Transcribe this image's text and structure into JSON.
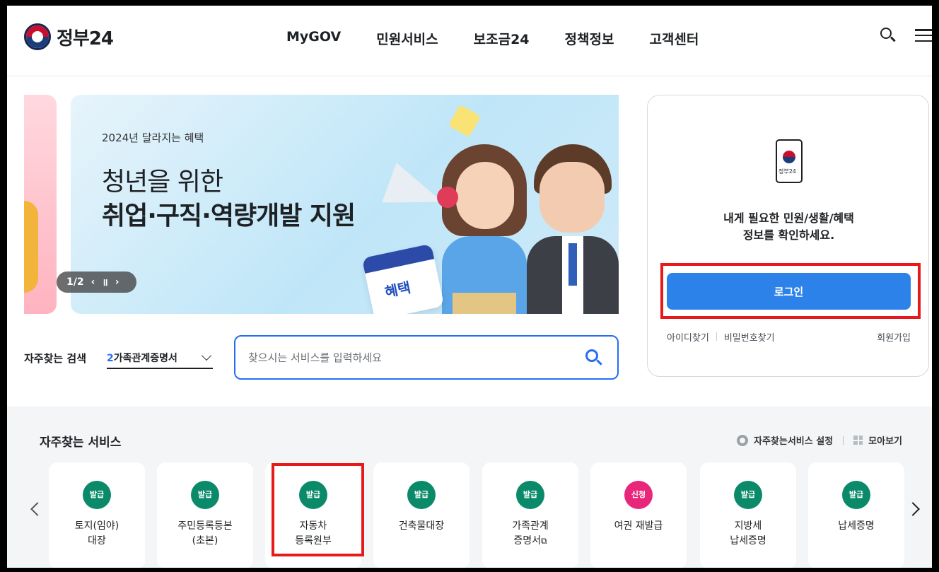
{
  "header": {
    "logo_text": "정부24",
    "nav": [
      "MyGOV",
      "민원서비스",
      "보조금24",
      "정책정보",
      "고객센터"
    ]
  },
  "banner": {
    "subtitle": "2024년 달라지는 혜택",
    "title_line1": "청년을 위한",
    "title_line2": "취업·구직·역량개발 지원",
    "calendar_label": "혜택",
    "pager": "1/2",
    "prev_symbol": "‹",
    "pause_symbol": "॥",
    "next_symbol": "›"
  },
  "frequent_search": {
    "label": "자주찾는 검색",
    "selected_number": "2",
    "selected_text": "가족관계증명서",
    "placeholder": "찾으시는 서비스를 입력하세요"
  },
  "login": {
    "app_name": "정부24",
    "message_line1": "내게 필요한 민원/생활/혜택",
    "message_line2": "정보를 확인하세요.",
    "button": "로그인",
    "find_id": "아이디찾기",
    "find_pw": "비밀번호찾기",
    "join": "회원가입"
  },
  "services": {
    "title": "자주찾는 서비스",
    "settings": "자주찾는서비스 설정",
    "view_all": "모아보기",
    "items": [
      {
        "badge": "발급",
        "line1": "토지(임야)",
        "line2": "대장",
        "badge_color": "#0b8a6a"
      },
      {
        "badge": "발급",
        "line1": "주민등록등본",
        "line2": "(초본)",
        "badge_color": "#0b8a6a"
      },
      {
        "badge": "발급",
        "line1": "자동차",
        "line2": "등록원부",
        "badge_color": "#0b8a6a"
      },
      {
        "badge": "발급",
        "line1": "건축물대장",
        "line2": "",
        "badge_color": "#0b8a6a"
      },
      {
        "badge": "발급",
        "line1": "가족관계",
        "line2": "증명서",
        "badge_color": "#0b8a6a"
      },
      {
        "badge": "신청",
        "line1": "여권 재발급",
        "line2": "",
        "badge_color": "#e8267a"
      },
      {
        "badge": "발급",
        "line1": "지방세",
        "line2": "납세증명",
        "badge_color": "#0b8a6a"
      },
      {
        "badge": "발급",
        "line1": "납세증명",
        "line2": "",
        "badge_color": "#0b8a6a"
      }
    ]
  },
  "colors": {
    "primary": "#256ef4",
    "login_button": "#2c82e8",
    "highlight": "#e8191a"
  }
}
